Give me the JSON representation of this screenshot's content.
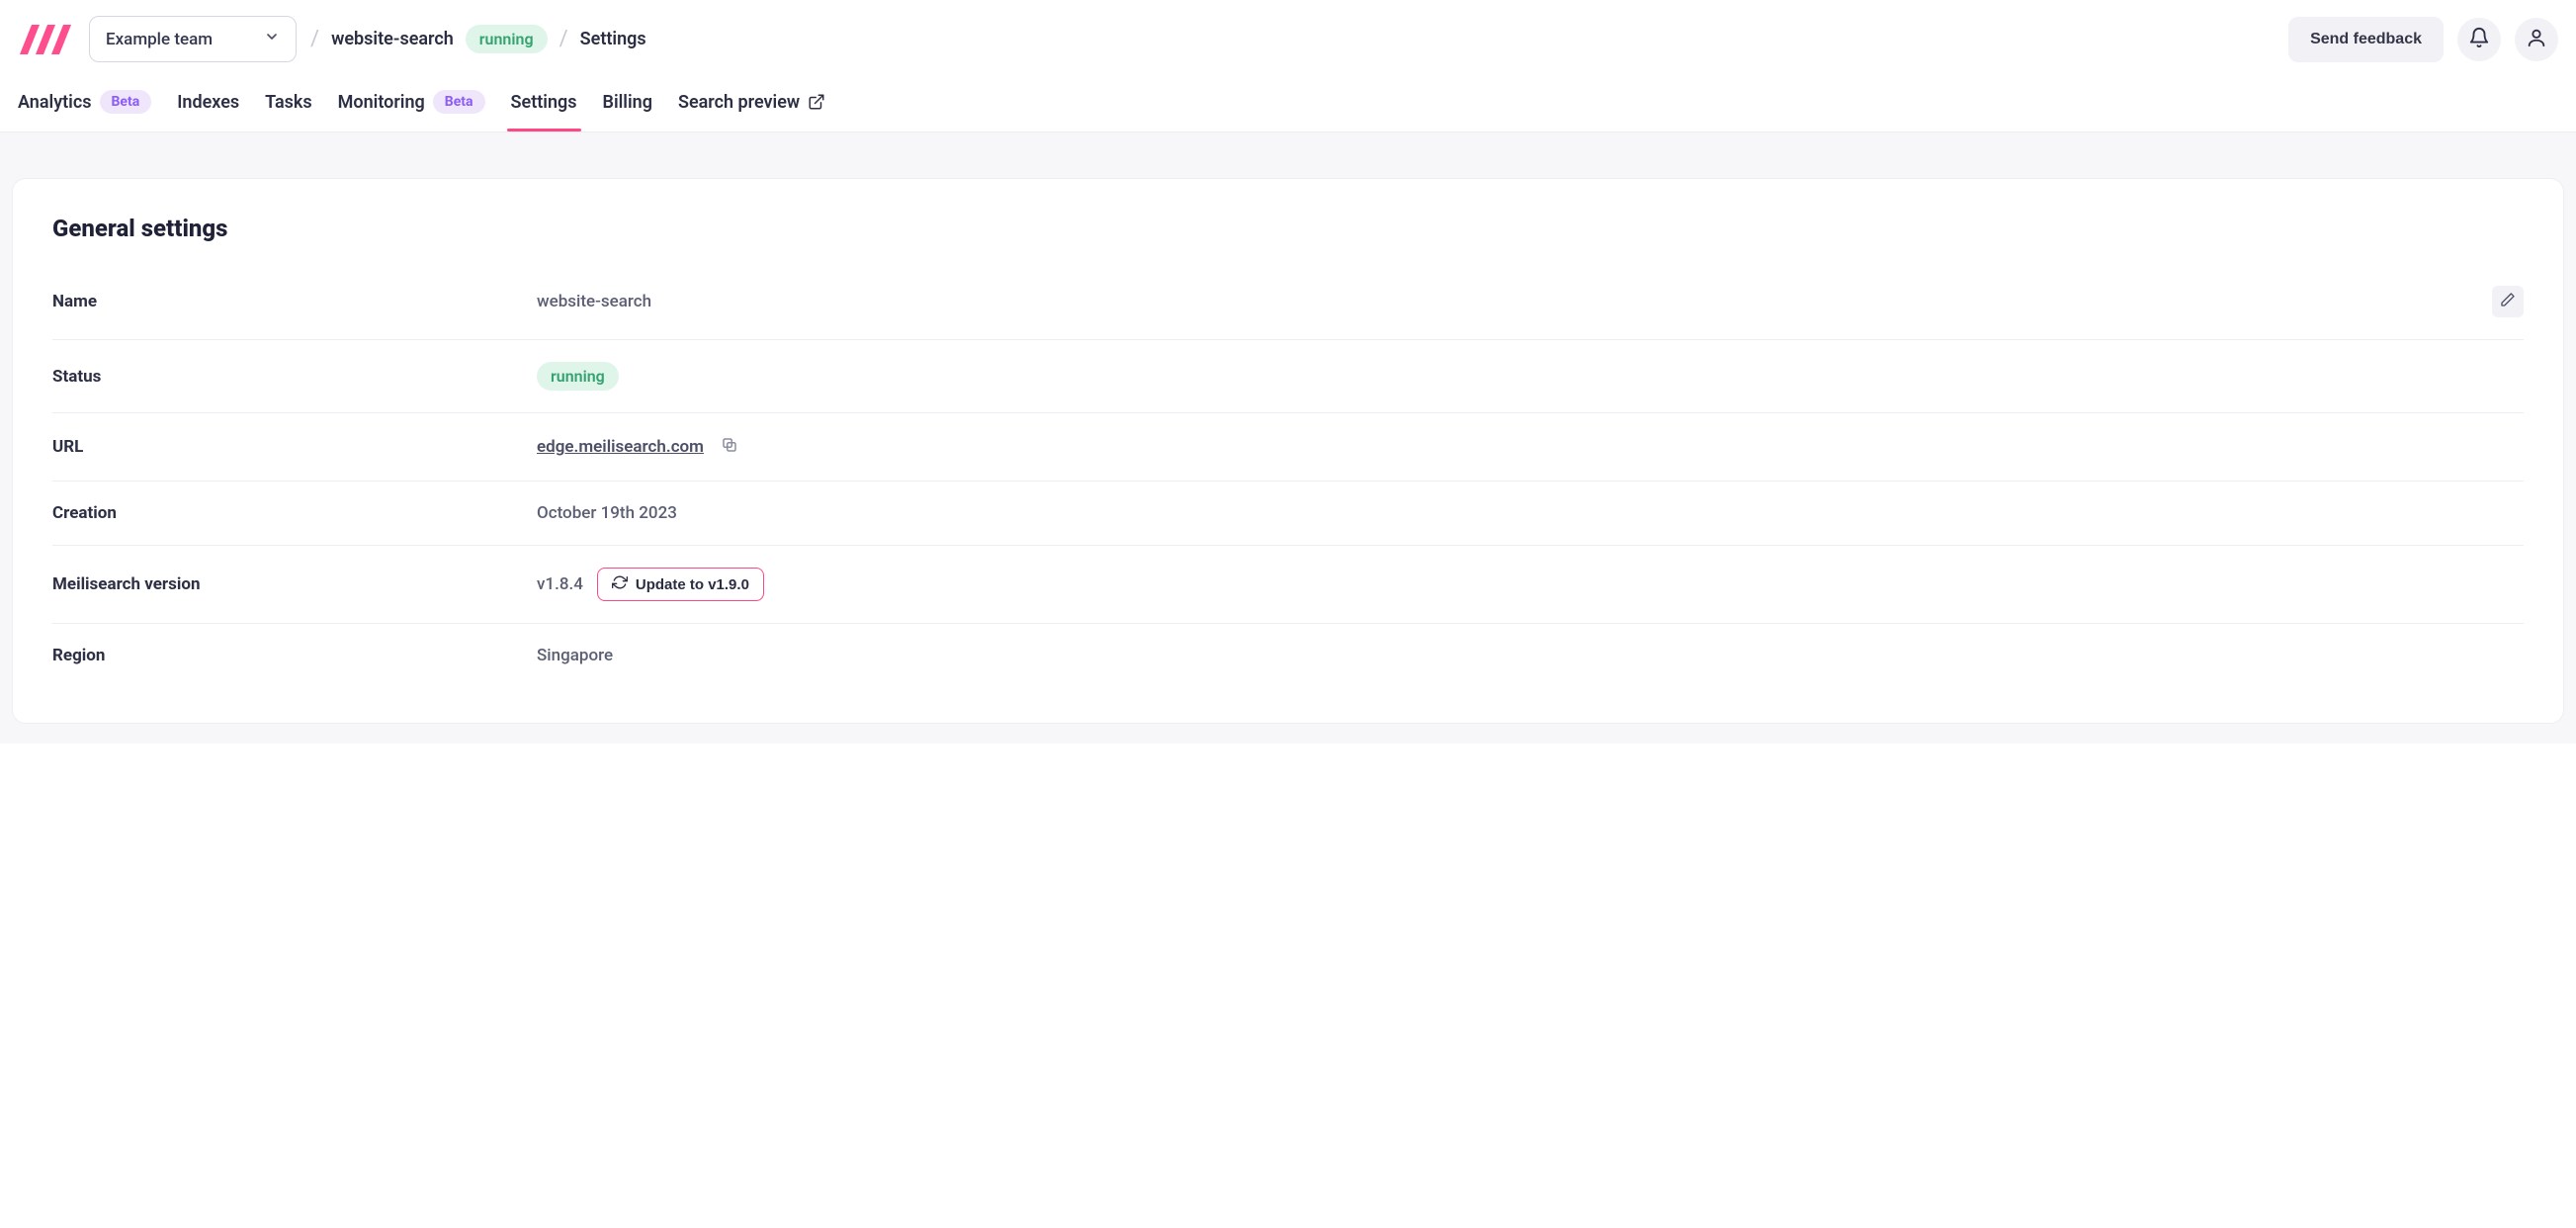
{
  "header": {
    "team": "Example team",
    "project": "website-search",
    "status": "running",
    "crumb_settings": "Settings",
    "feedback": "Send feedback"
  },
  "tabs": {
    "analytics": "Analytics",
    "indexes": "Indexes",
    "tasks": "Tasks",
    "monitoring": "Monitoring",
    "settings": "Settings",
    "billing": "Billing",
    "search_preview": "Search preview",
    "beta_label": "Beta"
  },
  "page": {
    "title": "General settings",
    "rows": {
      "name": {
        "label": "Name",
        "value": "website-search"
      },
      "status": {
        "label": "Status",
        "value": "running"
      },
      "url": {
        "label": "URL",
        "value": "edge.meilisearch.com"
      },
      "creation": {
        "label": "Creation",
        "value": "October 19th 2023"
      },
      "version": {
        "label": "Meilisearch version",
        "value": "v1.8.4",
        "update": "Update to v1.9.0"
      },
      "region": {
        "label": "Region",
        "value": "Singapore"
      }
    }
  }
}
